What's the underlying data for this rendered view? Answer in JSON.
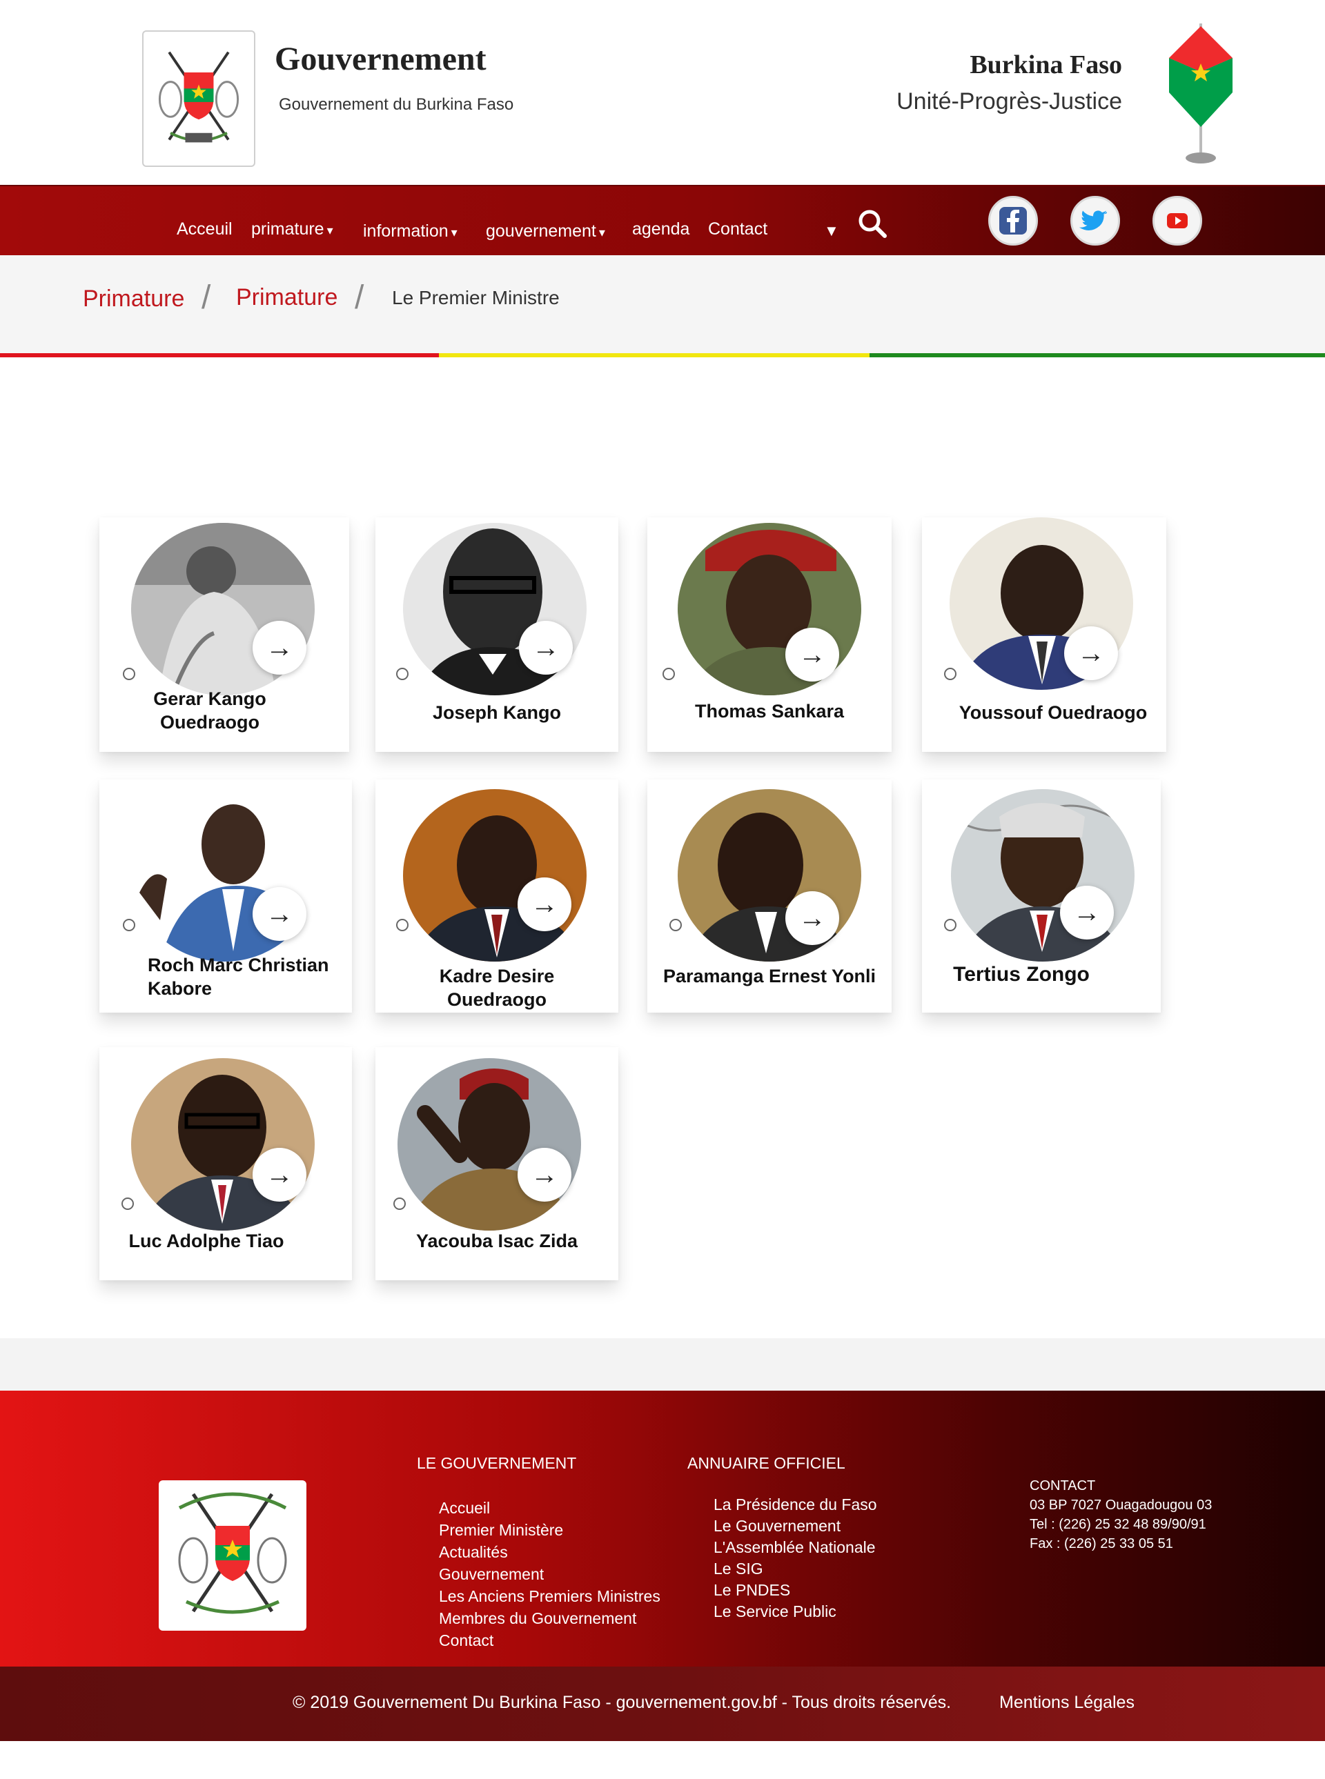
{
  "header": {
    "title": "Gouvernement",
    "subtitle": "Gouvernement du Burkina Faso",
    "country": "Burkina Faso",
    "motto": "Unité-Progrès-Justice"
  },
  "nav": {
    "items": [
      "Acceuil",
      "primature",
      "information",
      "gouvernement",
      "agenda",
      "Contact"
    ],
    "caret": "▾",
    "toggle": "▼",
    "social": [
      "facebook-icon",
      "twitter-icon",
      "youtube-icon"
    ]
  },
  "breadcrumb": {
    "items": [
      "Primature",
      "Primature",
      "Le Premier Ministre"
    ],
    "separator": "/"
  },
  "cards": {
    "arrow": "→",
    "items": [
      {
        "name": "Gerar Kango Ouedraogo"
      },
      {
        "name": "Joseph Kango"
      },
      {
        "name": "Thomas Sankara"
      },
      {
        "name": "Youssouf Ouedraogo"
      },
      {
        "name": "Roch Marc Christian Kabore"
      },
      {
        "name": "Kadre Desire Ouedraogo"
      },
      {
        "name": "Paramanga Ernest Yonli"
      },
      {
        "name": "Tertius Zongo"
      },
      {
        "name": "Luc Adolphe Tiao"
      },
      {
        "name": "Yacouba Isac Zida"
      }
    ]
  },
  "footer": {
    "col1": {
      "heading": "LE GOUVERNEMENT",
      "links": [
        "Accueil",
        "Premier Ministère",
        "Actualités",
        "Gouvernement",
        "Les Anciens Premiers Ministres",
        "Membres du Gouvernement",
        "Contact"
      ]
    },
    "col2": {
      "heading": "ANNUAIRE OFFICIEL",
      "links": [
        "La Présidence du Faso",
        "Le Gouvernement",
        "L'Assemblée Nationale",
        "Le SIG",
        "Le PNDES",
        "Le Service Public"
      ]
    },
    "contact": {
      "heading": "CONTACT",
      "address": "03 BP 7027 Ouagadougou 03",
      "tel": "Tel : (226) 25 32 48 89/90/91",
      "fax": "Fax : (226) 25 33 05 51"
    },
    "copyright": "© 2019 Gouvernement Du Burkina Faso - gouvernement.gov.bf - Tous droits réservés.",
    "legal": "Mentions Légales"
  },
  "colors": {
    "brand_red": "#a20a0a",
    "crumb_red": "#c0181e",
    "flag_red": "#ef2b2d",
    "flag_green": "#009e49",
    "flag_star": "#fcd116"
  }
}
